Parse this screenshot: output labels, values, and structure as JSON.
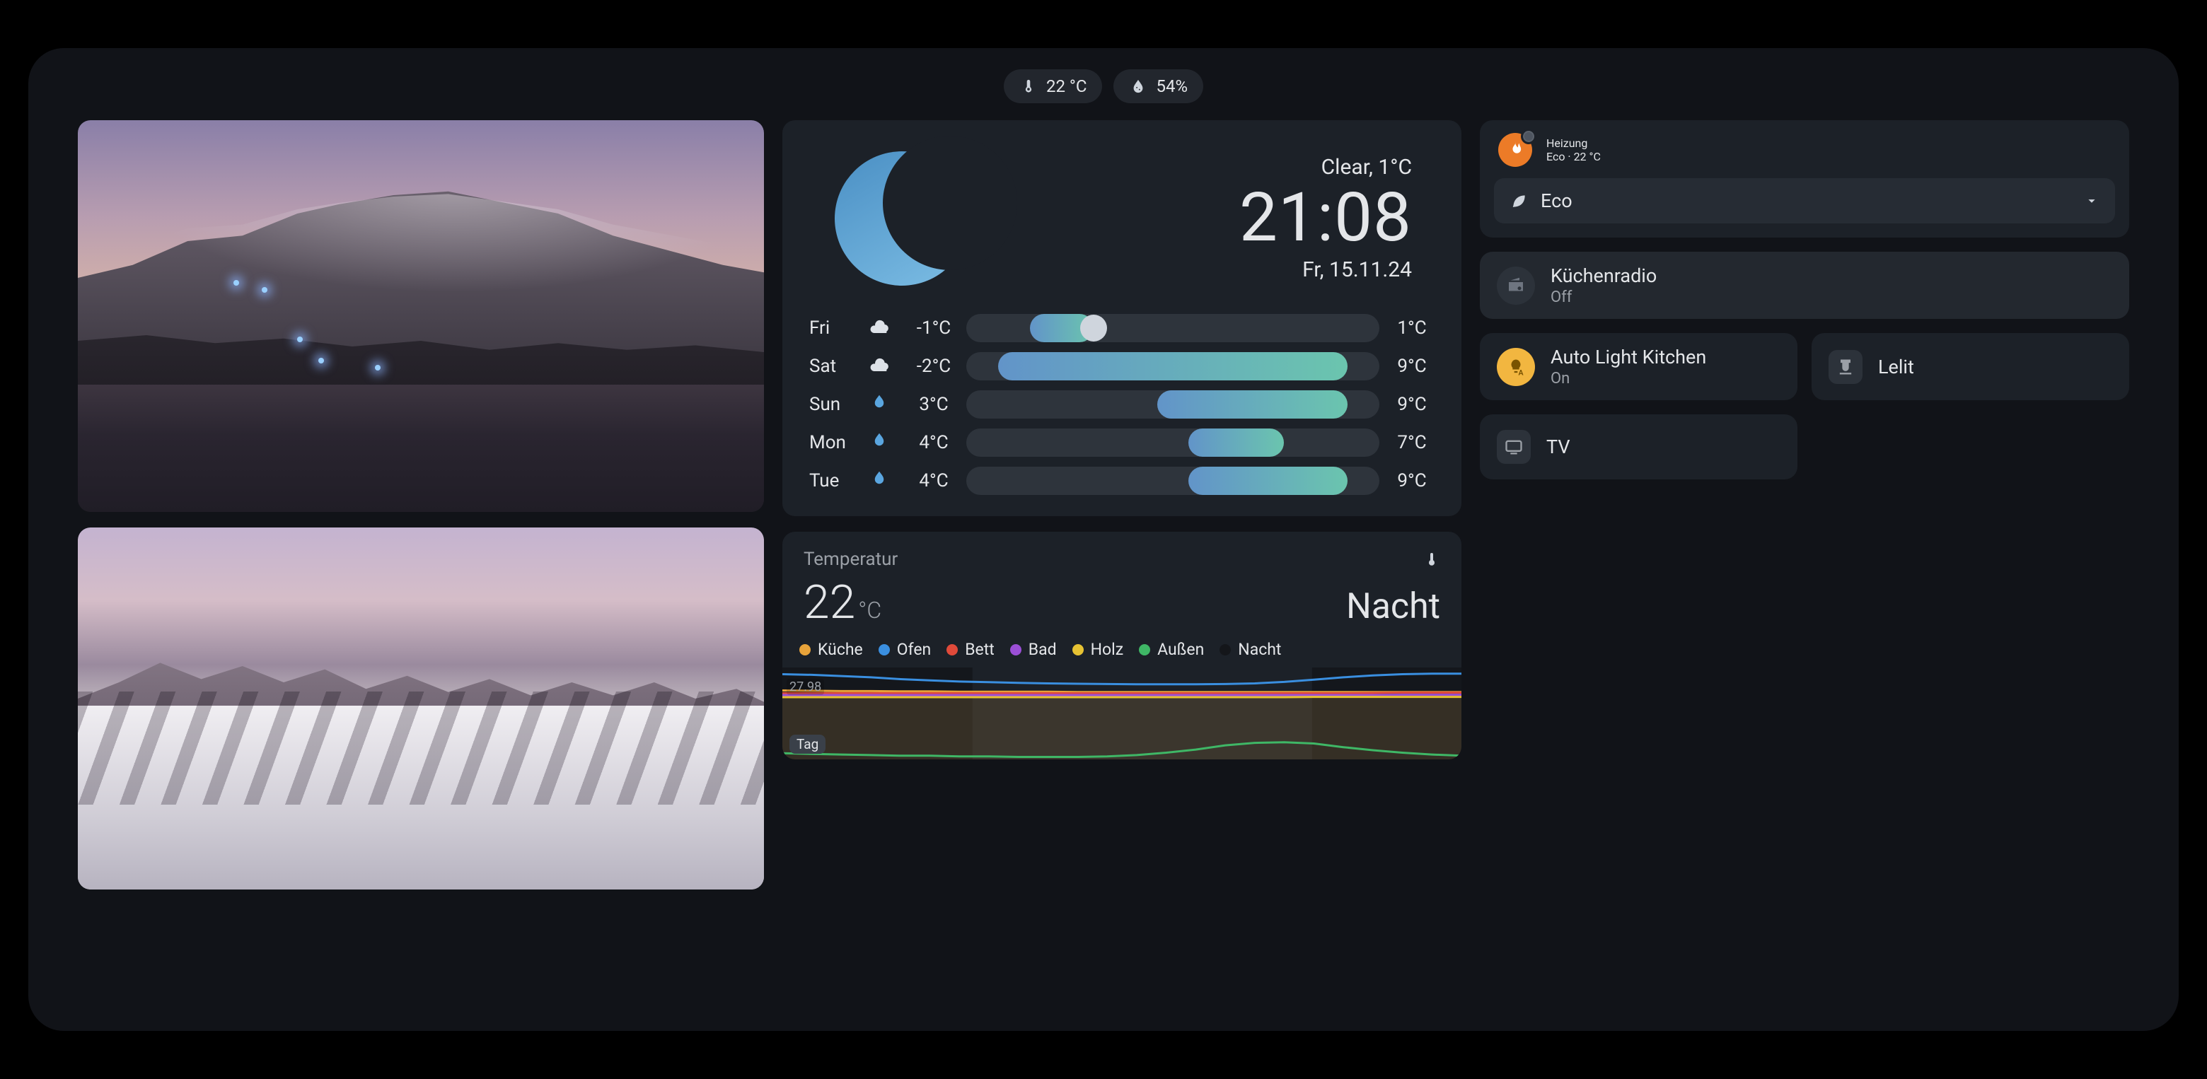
{
  "status": {
    "temperature": "22 °C",
    "humidity": "54%"
  },
  "weather": {
    "condition": "Clear, 1°C",
    "time": "21:08",
    "date": "Fr, 15.11.24",
    "scale_min": -3,
    "scale_max": 10,
    "now_temp": 1,
    "forecast": [
      {
        "day": "Fri",
        "icon": "cloud",
        "lo": -1,
        "hi": 1
      },
      {
        "day": "Sat",
        "icon": "cloud",
        "lo": -2,
        "hi": 9
      },
      {
        "day": "Sun",
        "icon": "rain",
        "lo": 3,
        "hi": 9
      },
      {
        "day": "Mon",
        "icon": "rain",
        "lo": 4,
        "hi": 7
      },
      {
        "day": "Tue",
        "icon": "rain",
        "lo": 4,
        "hi": 9
      }
    ]
  },
  "temperature_card": {
    "title": "Temperatur",
    "value": "22",
    "unit": "°C",
    "state": "Nacht",
    "y_label": "27.98",
    "x_tag": "Tag",
    "legend": [
      {
        "label": "Küche",
        "color": "#e8a33a"
      },
      {
        "label": "Ofen",
        "color": "#3a8fe0"
      },
      {
        "label": "Bett",
        "color": "#e04a3a"
      },
      {
        "label": "Bad",
        "color": "#9b4fd6"
      },
      {
        "label": "Holz",
        "color": "#e6c233"
      },
      {
        "label": "Außen",
        "color": "#3fb766"
      },
      {
        "label": "Nacht",
        "color": "#14161a"
      }
    ]
  },
  "chart_data": {
    "type": "line",
    "title": "Temperatur",
    "ylabel": "°C",
    "ylim": [
      0,
      30
    ],
    "x_range_hours": 24,
    "series": [
      {
        "name": "Küche",
        "color": "#e8a33a",
        "values": [
          22.5,
          22.4,
          22.3,
          22.3,
          22.2,
          22.2,
          22.1,
          22.1,
          22.1,
          22.1,
          22.0,
          22.0,
          22.0,
          22.0,
          22.0,
          22.0,
          22.0,
          22.0,
          22.0,
          22.0,
          22.0,
          22.0,
          22.0,
          22.0
        ]
      },
      {
        "name": "Ofen",
        "color": "#3a8fe0",
        "values": [
          27.8,
          27.6,
          27.2,
          26.8,
          26.2,
          25.8,
          25.4,
          25.2,
          25.0,
          24.8,
          24.7,
          24.6,
          24.5,
          24.5,
          24.5,
          24.6,
          24.8,
          25.3,
          26.0,
          26.8,
          27.4,
          27.8,
          28.0,
          28.0
        ]
      },
      {
        "name": "Bett",
        "color": "#e04a3a",
        "values": [
          21.6,
          21.6,
          21.6,
          21.6,
          21.6,
          21.6,
          21.6,
          21.6,
          21.6,
          21.6,
          21.6,
          21.6,
          21.6,
          21.6,
          21.6,
          21.6,
          21.6,
          21.6,
          21.6,
          21.6,
          21.7,
          21.8,
          21.8,
          21.8
        ]
      },
      {
        "name": "Bad",
        "color": "#9b4fd6",
        "values": [
          21.0,
          21.0,
          21.0,
          21.0,
          21.0,
          21.0,
          21.0,
          21.0,
          21.0,
          21.0,
          21.0,
          21.0,
          21.0,
          21.0,
          21.0,
          21.0,
          21.0,
          21.0,
          21.0,
          21.0,
          21.0,
          21.1,
          21.1,
          21.1
        ]
      },
      {
        "name": "Holz",
        "color": "#e6c233",
        "values": [
          20.3,
          20.3,
          20.3,
          20.3,
          20.3,
          20.3,
          20.3,
          20.3,
          20.3,
          20.3,
          20.3,
          20.3,
          20.3,
          20.3,
          20.3,
          20.3,
          20.3,
          20.3,
          20.4,
          20.4,
          20.4,
          20.4,
          20.4,
          20.4
        ]
      },
      {
        "name": "Außen",
        "color": "#3fb766",
        "values": [
          2.0,
          1.8,
          1.6,
          1.4,
          1.2,
          1.2,
          1.0,
          1.0,
          0.8,
          0.8,
          0.8,
          1.0,
          1.4,
          2.2,
          3.2,
          4.6,
          5.4,
          5.6,
          5.2,
          4.0,
          3.0,
          2.2,
          1.6,
          1.2
        ]
      }
    ],
    "state_track": {
      "name": "Nacht",
      "periods": [
        [
          0,
          0.28
        ],
        [
          0.78,
          1.0
        ]
      ]
    }
  },
  "heating": {
    "name": "Heizung",
    "subtitle": "Eco · 22 °C",
    "preset": "Eco"
  },
  "radio": {
    "name": "Küchenradio",
    "subtitle": "Off"
  },
  "auto_light": {
    "name": "Auto Light Kitchen",
    "subtitle": "On"
  },
  "lelit": {
    "name": "Lelit"
  },
  "tv": {
    "name": "TV"
  }
}
